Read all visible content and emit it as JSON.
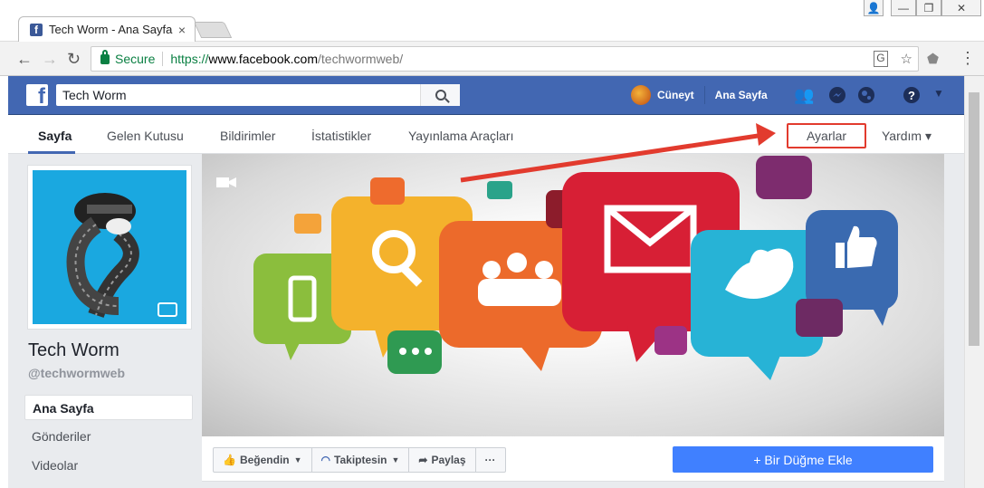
{
  "window": {
    "controls": [
      "👤",
      "—",
      "❐",
      "✕"
    ]
  },
  "tab": {
    "title": "Tech Worm - Ana Sayfa",
    "favicon": "f",
    "close": "×"
  },
  "toolbar": {
    "back": "←",
    "forward": "→",
    "reload": "↻",
    "secure_label": "Secure",
    "url_scheme": "https://",
    "url_host": "www.facebook.com",
    "url_path": "/techwormweb/",
    "translate_icon": "translate-icon",
    "star": "☆",
    "ext_icon": "shield-icon",
    "menu": "⋮"
  },
  "fb_header": {
    "logo": "f",
    "search_value": "Tech Worm",
    "user_name": "Cüneyt",
    "home_label": "Ana Sayfa",
    "icons": [
      "friends-icon",
      "messenger-icon",
      "globe-icon",
      "help-icon",
      "caret-down-icon"
    ],
    "help": "?",
    "caret": "▼"
  },
  "page_nav": {
    "items": [
      "Sayfa",
      "Gelen Kutusu",
      "Bildirimler",
      "İstatistikler",
      "Yayınlama Araçları"
    ],
    "settings": "Ayarlar",
    "help": "Yardım ▾"
  },
  "sidebar": {
    "page_name": "Tech Worm",
    "handle": "@techwormweb",
    "items": [
      "Ana Sayfa",
      "Gönderiler",
      "Videolar"
    ]
  },
  "actions": {
    "like": "Beğendin",
    "follow": "Takiptesin",
    "share": "Paylaş",
    "more": "···",
    "cta": "+ Bir Düğme Ekle"
  },
  "colors": {
    "fb_blue": "#4267b2",
    "cta_blue": "#4080ff",
    "highlight_red": "#e23b2e",
    "secure_green": "#0b8043"
  }
}
